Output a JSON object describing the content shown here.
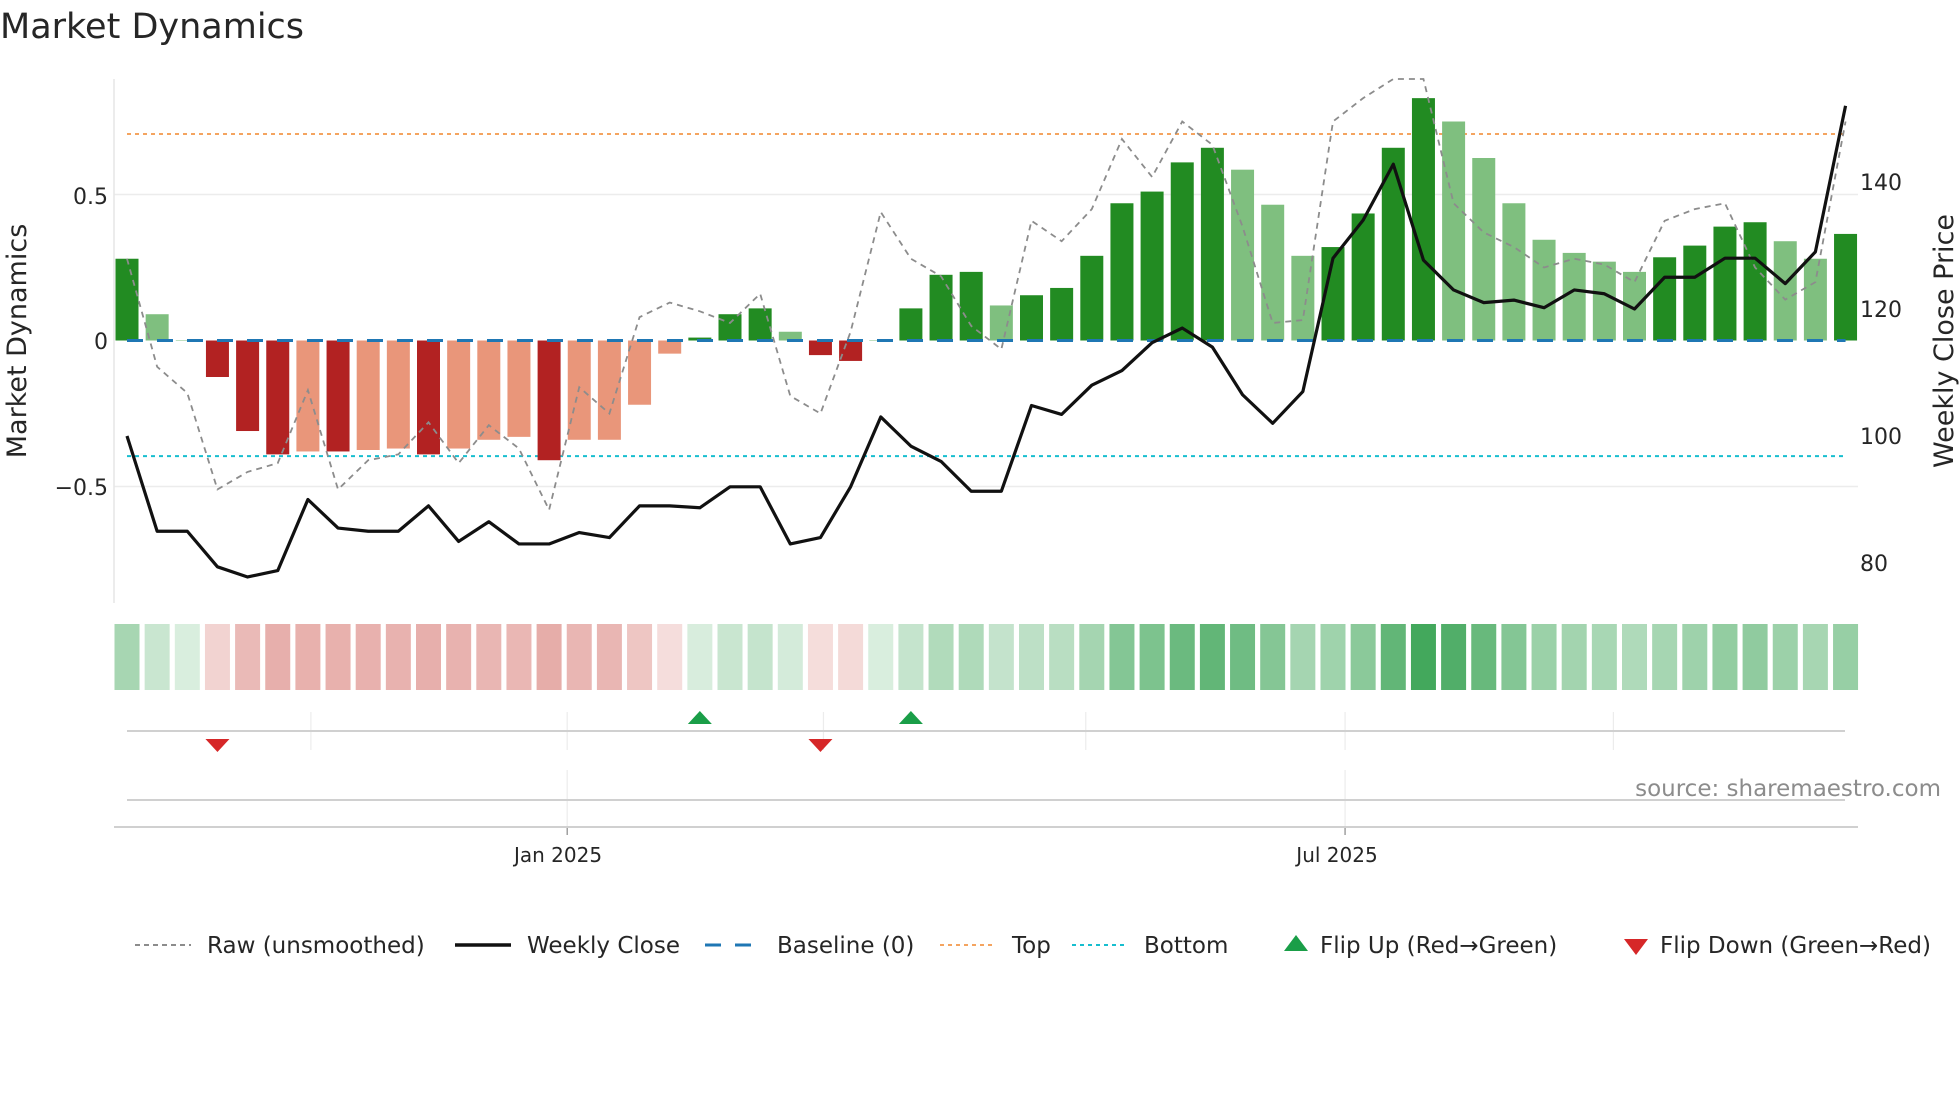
{
  "chart_data": {
    "type": "bar",
    "title": "Market Dynamics",
    "ylabel": "Market Dynamics",
    "ylabel_right": "Weekly Close Price",
    "ylim": [
      -0.9,
      0.9
    ],
    "ylim_right": [
      60,
      158
    ],
    "yticks": [
      {
        "value": 0.5,
        "label": "0.5"
      },
      {
        "value": 0,
        "label": "0"
      },
      {
        "value": -0.5,
        "label": "−0.5"
      }
    ],
    "yticks_right": [
      {
        "value": 140,
        "label": "140"
      },
      {
        "value": 120,
        "label": "120"
      },
      {
        "value": 100,
        "label": "100"
      },
      {
        "value": 80,
        "label": "80"
      }
    ],
    "xticks": [
      {
        "index": 14.6,
        "label": "Jan 2025"
      },
      {
        "index": 40.4,
        "label": "Jul 2025"
      }
    ],
    "month_grid_indices": [
      6.1,
      14.6,
      23.1,
      31.8,
      40.4,
      49.3
    ],
    "top_level": 0.707,
    "bottom_level": -0.396,
    "baseline": 0,
    "smoothed": [
      0.28,
      0.09,
      0,
      -0.125,
      -0.31,
      -0.39,
      -0.38,
      -0.38,
      -0.375,
      -0.37,
      -0.39,
      -0.37,
      -0.34,
      -0.33,
      -0.41,
      -0.34,
      -0.34,
      -0.22,
      -0.045,
      0.01,
      0.09,
      0.11,
      0.03,
      -0.05,
      -0.07,
      0,
      0.11,
      0.225,
      0.235,
      0.12,
      0.155,
      0.18,
      0.29,
      0.47,
      0.51,
      0.61,
      0.66,
      0.585,
      0.465,
      0.29,
      0.32,
      0.435,
      0.66,
      0.83,
      0.75,
      0.625,
      0.47,
      0.345,
      0.3,
      0.27,
      0.235,
      0.285,
      0.325,
      0.39,
      0.405,
      0.34,
      0.28,
      0.365
    ],
    "strengthening": [
      1,
      0,
      0,
      1,
      1,
      1,
      0,
      1,
      0,
      0,
      1,
      0,
      0,
      0,
      1,
      0,
      0,
      0,
      0,
      1,
      1,
      1,
      0,
      1,
      1,
      0,
      1,
      1,
      1,
      0,
      1,
      1,
      1,
      1,
      1,
      1,
      1,
      0,
      0,
      0,
      1,
      1,
      1,
      1,
      0,
      0,
      0,
      0,
      0,
      0,
      0,
      1,
      1,
      1,
      1,
      0,
      0,
      1
    ],
    "raw": [
      0.28,
      -0.09,
      -0.18,
      -0.51,
      -0.45,
      -0.42,
      -0.17,
      -0.51,
      -0.41,
      -0.39,
      -0.28,
      -0.42,
      -0.29,
      -0.37,
      -0.58,
      -0.16,
      -0.25,
      0.08,
      0.13,
      0.1,
      0.06,
      0.16,
      -0.19,
      -0.25,
      0.03,
      0.44,
      0.28,
      0.22,
      0.05,
      -0.03,
      0.41,
      0.34,
      0.45,
      0.69,
      0.56,
      0.75,
      0.67,
      0.39,
      0.06,
      0.07,
      0.75,
      0.83,
      0.92,
      0.92,
      0.47,
      0.37,
      0.32,
      0.25,
      0.28,
      0.26,
      0.2,
      0.41,
      0.45,
      0.47,
      0.25,
      0.14,
      0.2,
      0.75
    ],
    "close": [
      100,
      85,
      85,
      79.4,
      77.8,
      78.8,
      90,
      85.5,
      85,
      85,
      89,
      83.4,
      86.5,
      83,
      83,
      84.8,
      84,
      89,
      89,
      88.7,
      92,
      92,
      83,
      84,
      92,
      103,
      98.4,
      96,
      91.3,
      91.3,
      104.8,
      103.4,
      108,
      110.3,
      114.7,
      117,
      114,
      106.5,
      102,
      107,
      128,
      134,
      142.8,
      127.7,
      123,
      121,
      121.4,
      120.2,
      123,
      122.4,
      120,
      125,
      125,
      128,
      128,
      124,
      129,
      152
    ],
    "flips": [
      {
        "index": 3,
        "dir": "down"
      },
      {
        "index": 19,
        "dir": "up"
      },
      {
        "index": 23,
        "dir": "down"
      },
      {
        "index": 26,
        "dir": "up"
      }
    ],
    "colors": {
      "pos_strong": "#228b22",
      "pos_weak": "#7fbf7f",
      "neg_strong": "#b22222",
      "neg_weak": "#e9967a",
      "raw": "#8c8c8c",
      "close": "#111111",
      "baseline": "#1f77b4",
      "top": "#f4a460",
      "bottom": "#17becf",
      "flip_up": "#1a9e48",
      "flip_down": "#d62728",
      "heat_pos": "#2e9e4a",
      "heat_neg": "#c94a42"
    },
    "legend": {
      "placement": "bottom",
      "items": [
        {
          "label": "Raw (unsmoothed)",
          "kind": "raw"
        },
        {
          "label": "Weekly Close",
          "kind": "close"
        },
        {
          "label": "Baseline (0)",
          "kind": "baseline"
        },
        {
          "label": "Top",
          "kind": "top"
        },
        {
          "label": "Bottom",
          "kind": "bottom"
        },
        {
          "label": "Flip Up (Red→Green)",
          "kind": "up"
        },
        {
          "label": "Flip Down (Green→Red)",
          "kind": "down"
        }
      ]
    },
    "source": "source: sharemaestro.com"
  }
}
